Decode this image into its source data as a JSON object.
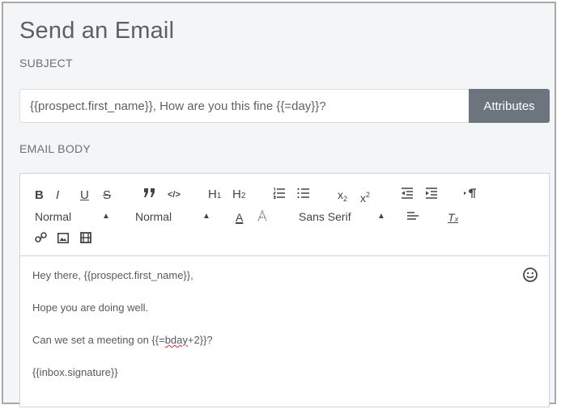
{
  "header": {
    "title": "Send an Email"
  },
  "subject": {
    "label": "SUBJECT",
    "value": "{{prospect.first_name}}, How are you this fine {{=day}}?",
    "attributes_button": "Attributes"
  },
  "body": {
    "label": "EMAIL BODY",
    "toolbar": {
      "bold": "B",
      "italic": "I",
      "underline": "U",
      "strike": "S",
      "blockquote": "99",
      "code": "</>",
      "h1": "H1",
      "h2": "H2",
      "subscript": "x2",
      "superscript": "x2",
      "size_value": "Normal",
      "header_value": "Normal",
      "font_value": "Sans Serif"
    },
    "lines": [
      "Hey there, {{prospect.first_name}},",
      "Hope you are doing well.",
      "Can we set a meeting on {{=bday+2}}?",
      "{{inbox.signature}}"
    ],
    "line3_prefix": "Can we set a meeting on {{=",
    "line3_misspelled": "bday",
    "line3_suffix": "+2}}?"
  },
  "colors": {
    "button_bg": "#6c757d",
    "panel_bg": "#f4f5f7",
    "border": "#a9a9a9"
  }
}
